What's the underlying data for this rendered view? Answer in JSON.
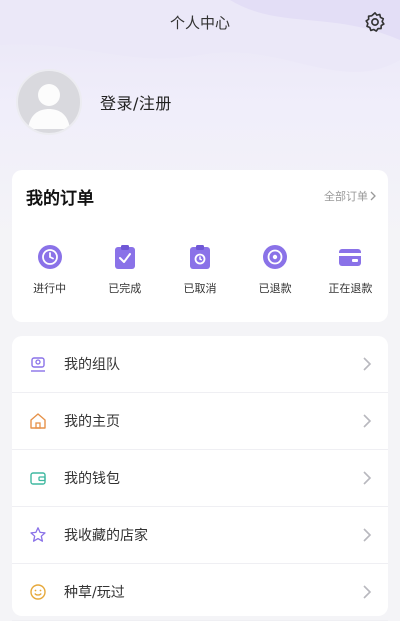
{
  "header": {
    "title": "个人中心",
    "settings_icon": "gear-icon"
  },
  "profile": {
    "avatar_icon": "avatar-placeholder-icon",
    "login_label": "登录/注册"
  },
  "orders": {
    "title": "我的订单",
    "all_label": "全部订单",
    "items": [
      {
        "label": "进行中",
        "icon": "clock-icon"
      },
      {
        "label": "已完成",
        "icon": "clipboard-check-icon"
      },
      {
        "label": "已取消",
        "icon": "clipboard-cancel-icon"
      },
      {
        "label": "已退款",
        "icon": "coin-icon"
      },
      {
        "label": "正在退款",
        "icon": "wallet-icon"
      }
    ]
  },
  "menu": {
    "items": [
      {
        "label": "我的组队",
        "icon": "team-icon"
      },
      {
        "label": "我的主页",
        "icon": "home-icon"
      },
      {
        "label": "我的钱包",
        "icon": "wallet-icon"
      },
      {
        "label": "我收藏的店家",
        "icon": "star-icon"
      },
      {
        "label": "种草/玩过",
        "icon": "smile-icon"
      }
    ]
  },
  "colors": {
    "accent": "#8a72e8",
    "background": "#f4f4f7",
    "card": "#ffffff"
  }
}
